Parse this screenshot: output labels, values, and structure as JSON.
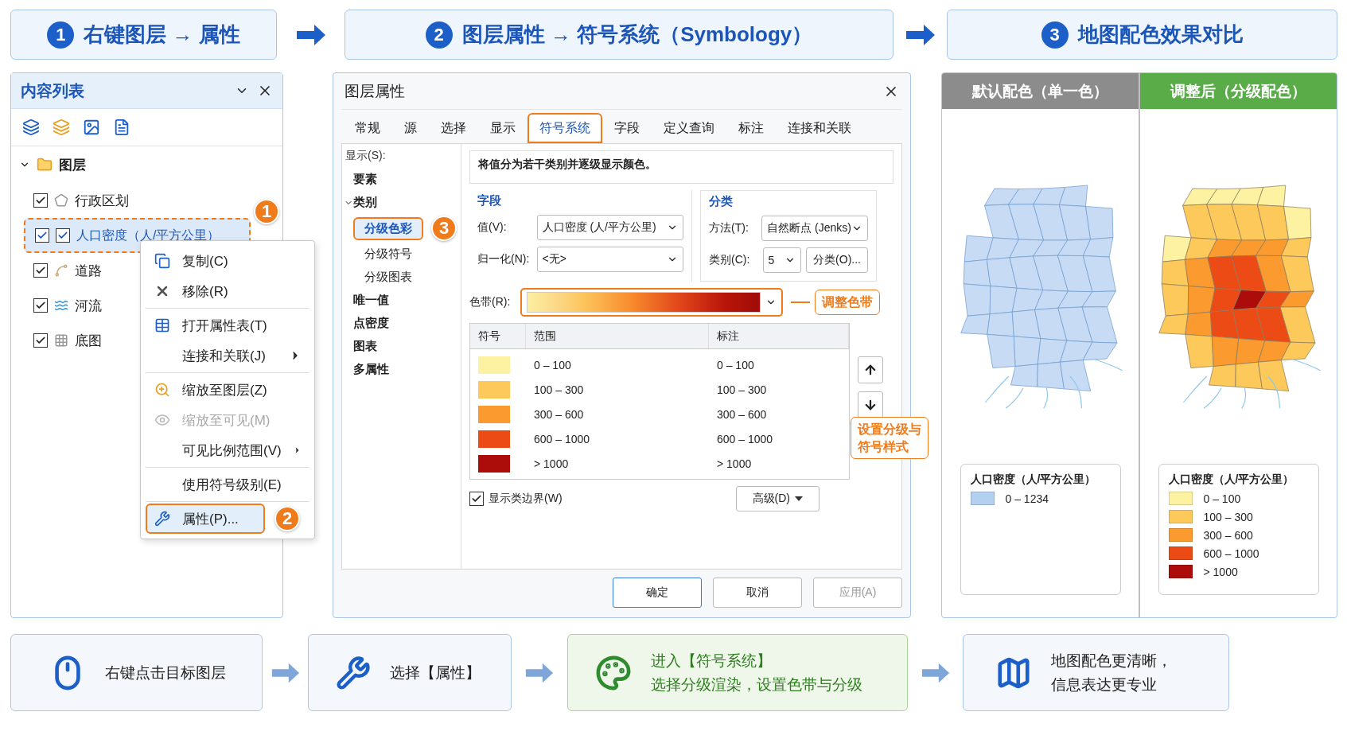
{
  "steps": [
    {
      "number": "1",
      "title": "右键图层 → 属性"
    },
    {
      "number": "2",
      "title": "图层属性 → 符号系统（Symbology）"
    },
    {
      "number": "3",
      "title": "地图配色效果对比"
    }
  ],
  "contents_panel": {
    "title": "内容列表",
    "root": {
      "label": "图层",
      "expanded": true,
      "children": [
        {
          "label": "行政区划",
          "kind": "polygon",
          "checked": true,
          "selected": false
        },
        {
          "label": "人口密度（人/平方公里）",
          "kind": "density",
          "checked": true,
          "selected": true,
          "badge": "1"
        },
        {
          "label": "道路",
          "kind": "road",
          "checked": true,
          "selected": false
        },
        {
          "label": "河流",
          "kind": "river",
          "checked": true,
          "selected": false
        },
        {
          "label": "底图",
          "kind": "grid",
          "checked": true,
          "selected": false
        }
      ]
    }
  },
  "context_menu": {
    "groups": [
      [
        {
          "label": "复制(C)",
          "kind": "copy",
          "disabled": false,
          "submenu": false,
          "selected": false
        },
        {
          "label": "移除(R)",
          "kind": "remove",
          "disabled": false,
          "submenu": false,
          "selected": false
        }
      ],
      [
        {
          "label": "打开属性表(T)",
          "kind": "table",
          "disabled": false,
          "submenu": false,
          "selected": false
        },
        {
          "label": "连接和关联(J)",
          "kind": "none",
          "disabled": false,
          "submenu": true,
          "selected": false
        }
      ],
      [
        {
          "label": "缩放至图层(Z)",
          "kind": "zoom",
          "disabled": false,
          "submenu": false,
          "selected": false
        },
        {
          "label": "缩放至可见(M)",
          "kind": "visible",
          "disabled": true,
          "submenu": false,
          "selected": false
        },
        {
          "label": "可见比例范围(V)",
          "kind": "none",
          "disabled": false,
          "submenu": true,
          "selected": false
        }
      ],
      [
        {
          "label": "使用符号级别(E)",
          "kind": "none",
          "disabled": false,
          "submenu": false,
          "selected": false
        }
      ],
      [
        {
          "label": "属性(P)...",
          "kind": "wrench",
          "disabled": false,
          "submenu": false,
          "selected": true,
          "badge": "2"
        }
      ]
    ]
  },
  "dialog": {
    "title": "图层属性",
    "tabs": [
      {
        "label": "常规",
        "selected": false
      },
      {
        "label": "源",
        "selected": false
      },
      {
        "label": "选择",
        "selected": false
      },
      {
        "label": "显示",
        "selected": false
      },
      {
        "label": "符号系统",
        "selected": true
      },
      {
        "label": "字段",
        "selected": false
      },
      {
        "label": "定义查询",
        "selected": false
      },
      {
        "label": "标注",
        "selected": false
      },
      {
        "label": "连接和关联",
        "selected": false
      }
    ],
    "show_label": "显示(S):",
    "categories": [
      {
        "label": "要素"
      },
      {
        "label": "类别",
        "expanded": true,
        "children": [
          {
            "label": "分级色彩",
            "selected": true,
            "badge": "3"
          },
          {
            "label": "分级符号",
            "selected": false
          },
          {
            "label": "分级图表",
            "selected": false
          }
        ]
      },
      {
        "label": "唯一值"
      },
      {
        "label": "点密度"
      },
      {
        "label": "图表"
      },
      {
        "label": "多属性"
      }
    ],
    "description": "将值分为若干类别并逐级显示颜色。",
    "field_group": {
      "title": "字段",
      "value_label": "值(V):",
      "value": "人口密度 (人/平方公里)",
      "normalize_label": "归一化(N):",
      "normalize": "<无>"
    },
    "class_group": {
      "title": "分类",
      "method_label": "方法(T):",
      "method": "自然断点 (Jenks)",
      "count_label": "类别(C):",
      "count": "5",
      "classify_button": "分类(O)..."
    },
    "ramp": {
      "label": "色带(R):",
      "callout": "调整色带"
    },
    "table": {
      "columns": [
        "符号",
        "范围",
        "标注"
      ],
      "rows": [
        {
          "color": "#fdf2a2",
          "range": "0 – 100",
          "label": "0 – 100"
        },
        {
          "color": "#fdc95a",
          "range": "100 – 300",
          "label": "100 – 300"
        },
        {
          "color": "#fb9a2f",
          "range": "300 – 600",
          "label": "300 – 600"
        },
        {
          "color": "#ec4b16",
          "range": "600 – 1000",
          "label": "600 – 1000"
        },
        {
          "color": "#ac0d0a",
          "range": "> 1000",
          "label": "> 1000"
        }
      ]
    },
    "table_callout": [
      "设置分级与",
      "符号样式"
    ],
    "show_boundaries": {
      "label": "显示类边界(W)",
      "checked": true
    },
    "advanced": "高级(D)",
    "buttons": [
      {
        "label": "确定",
        "kind": "primary"
      },
      {
        "label": "取消",
        "kind": "normal"
      },
      {
        "label": "应用(A)",
        "kind": "disabled"
      }
    ]
  },
  "comparison": [
    {
      "title": "默认配色（单一色）",
      "color": "#8c8c8c",
      "kind": "single",
      "legend": {
        "title": "人口密度（人/平方公里）",
        "items": [
          {
            "color": "#b3d0f0",
            "label": "0 – 1234"
          }
        ]
      }
    },
    {
      "title": "调整后（分级配色）",
      "color": "#5aac48",
      "kind": "graduated",
      "legend": {
        "title": "人口密度（人/平方公里）",
        "items": [
          {
            "color": "#fdf2a2",
            "label": "0 – 100"
          },
          {
            "color": "#fdc95a",
            "label": "100 – 300"
          },
          {
            "color": "#fb9a2f",
            "label": "300 – 600"
          },
          {
            "color": "#ec4b16",
            "label": "600 – 1000"
          },
          {
            "color": "#ac0d0a",
            "label": "> 1000"
          }
        ]
      }
    }
  ],
  "flow": [
    {
      "kind": "mouse",
      "lines": [
        "右键点击目标图层"
      ],
      "highlighted": false
    },
    {
      "kind": "wrench",
      "lines": [
        "选择【属性】"
      ],
      "highlighted": false
    },
    {
      "kind": "palette",
      "lines": [
        "进入【符号系统】",
        "选择分级渲染，设置色带与分级"
      ],
      "highlighted": true
    },
    {
      "kind": "map",
      "lines": [
        "地图配色更清晰，",
        "信息表达更专业"
      ],
      "highlighted": false
    }
  ]
}
